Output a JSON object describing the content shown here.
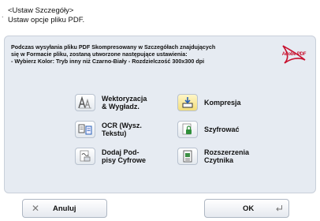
{
  "header": {
    "title": "<Ustaw Szczegóły>",
    "subtitle": "Ustaw opcje pliku PDF."
  },
  "description": {
    "line1": "Podczas wysyłania pliku PDF Skompresowany w Szczegółach znajdujących",
    "line2": "się w Formacie pliku, zostaną utworzone następujące ustawienia:",
    "line3": "- Wybierz Kolor: Tryb inny niż Czarno-Biały  - Rozdzielczość 300x300 dpi"
  },
  "logo": {
    "text": "Adobe PDF"
  },
  "options": [
    {
      "line1": "Wektoryzacja",
      "line2": "& Wygładz.",
      "icon": "vectorize-icon"
    },
    {
      "line1": "Kompresja",
      "line2": "",
      "icon": "compress-icon"
    },
    {
      "line1": "OCR (Wysz.",
      "line2": "Tekstu)",
      "icon": "ocr-icon"
    },
    {
      "line1": "Szyfrować",
      "line2": "",
      "icon": "encrypt-lock-icon"
    },
    {
      "line1": "Dodaj Pod-",
      "line2": "pisy Cyfrowe",
      "icon": "digital-signature-icon"
    },
    {
      "line1": "Rozszerzenia",
      "line2": "Czytnika",
      "icon": "reader-extensions-icon"
    }
  ],
  "buttons": {
    "cancel": "Anuluj",
    "ok": "OK"
  },
  "colors": {
    "panel_bg": "#e6ebf2",
    "button_bg": "#f0f3f7",
    "adobe_red": "#c8102e"
  }
}
